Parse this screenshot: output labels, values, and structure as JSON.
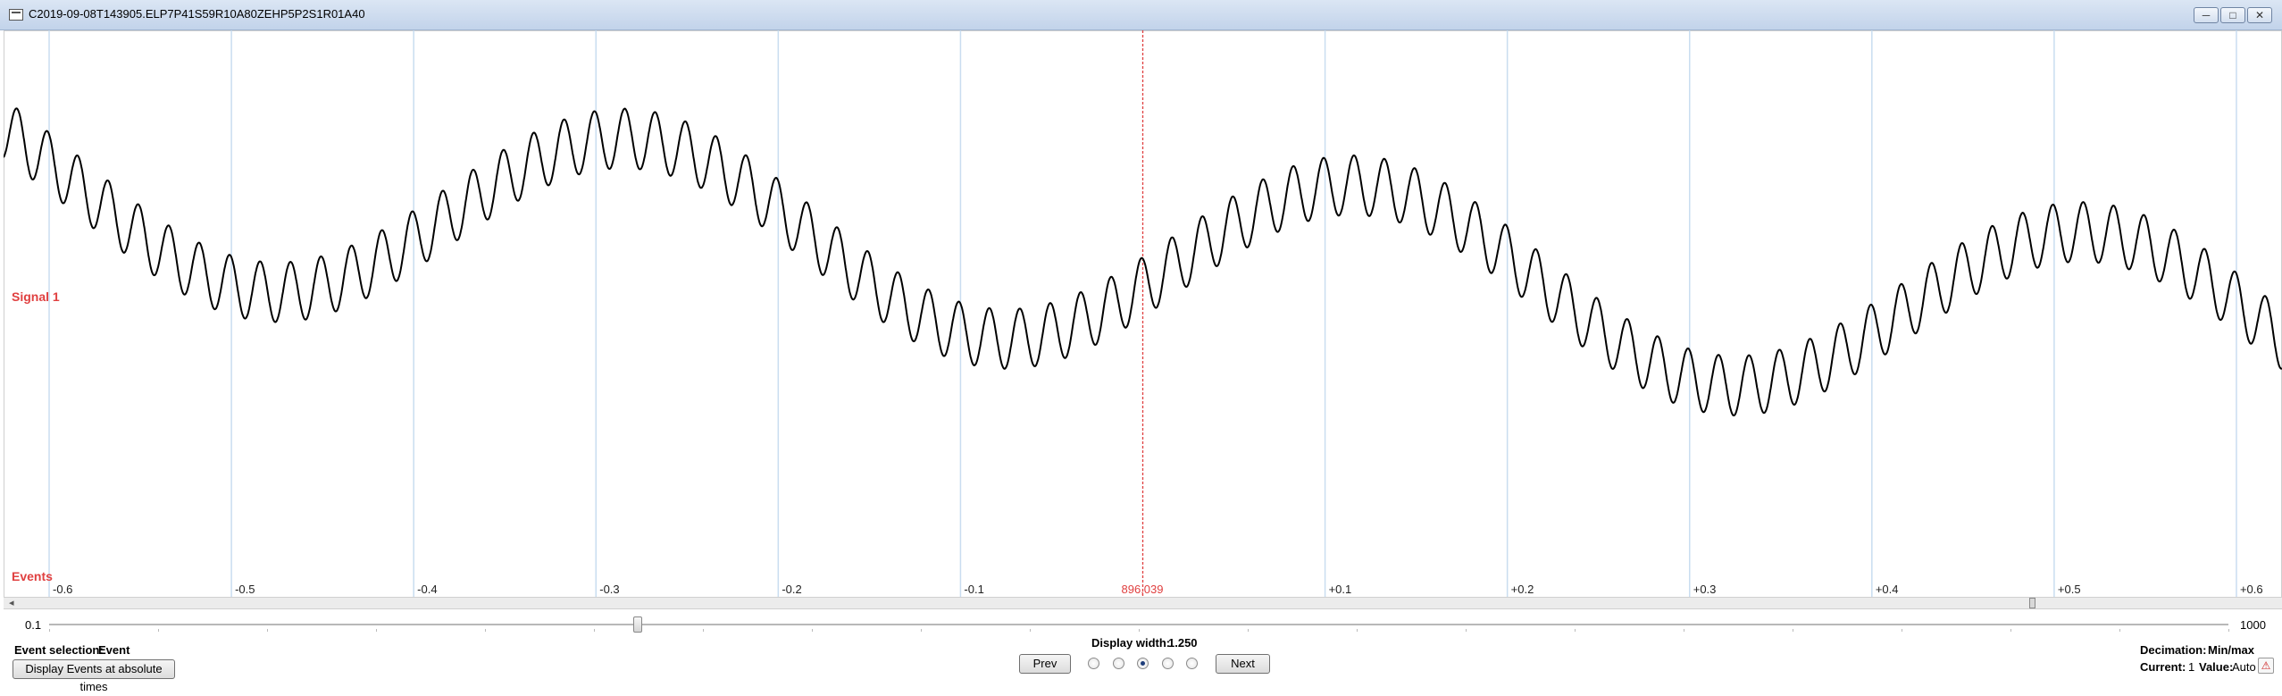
{
  "window": {
    "title": "C2019-09-08T143905.ELP7P41S59R10A80ZEHP5P2S1R01A40",
    "min_glyph": "─",
    "max_glyph": "□",
    "close_glyph": "✕"
  },
  "plot": {
    "signal_label": "Signal 1",
    "events_label": "Events",
    "cursor_label": "896,039",
    "cursor_color": "#e04040",
    "trace_color": "#000000",
    "gridline_color": "#c9ddf0",
    "scroll_left_glyph": "◂"
  },
  "chart_data": {
    "type": "line",
    "x_ticks": [
      "-0.6",
      "-0.5",
      "-0.4",
      "-0.3",
      "-0.2",
      "-0.1",
      "+0.1",
      "+0.2",
      "+0.3",
      "+0.4",
      "+0.5",
      "+0.6"
    ],
    "x_tick_values": [
      -0.6,
      -0.5,
      -0.4,
      -0.3,
      -0.2,
      -0.1,
      0.1,
      0.2,
      0.3,
      0.4,
      0.5,
      0.6
    ],
    "xlim": [
      -0.625,
      0.625
    ],
    "cursor_x": 0,
    "series": [
      {
        "components": [
          {
            "kind": "carrier",
            "amplitude": 0.34,
            "period": 0.4,
            "phase_x": 0.02
          },
          {
            "kind": "ripple",
            "amplitude": 0.115,
            "period": 0.01667,
            "phase_x": -0.005
          },
          {
            "kind": "trend",
            "slope": -0.45,
            "offset": 0.18
          }
        ]
      }
    ],
    "ylim": [
      -1.05,
      1.05
    ]
  },
  "controls": {
    "zoom_min": "0.1",
    "zoom_max": "1000",
    "zoom_position": 0.27,
    "event_selection_label": "Event selection:",
    "event_selection_value": "Event",
    "display_events_button": "Display Events at absolute times",
    "display_width_label": "Display width:",
    "display_width_value": "1.250",
    "prev_button": "Prev",
    "next_button": "Next",
    "radio_count": 5,
    "radio_selected_index": 2,
    "decimation_label": "Decimation:",
    "decimation_value": "Min/max",
    "current_label": "Current:",
    "current_value": "1",
    "value_label": "Value:",
    "value_value": "Auto",
    "warning_glyph": "⚠"
  }
}
